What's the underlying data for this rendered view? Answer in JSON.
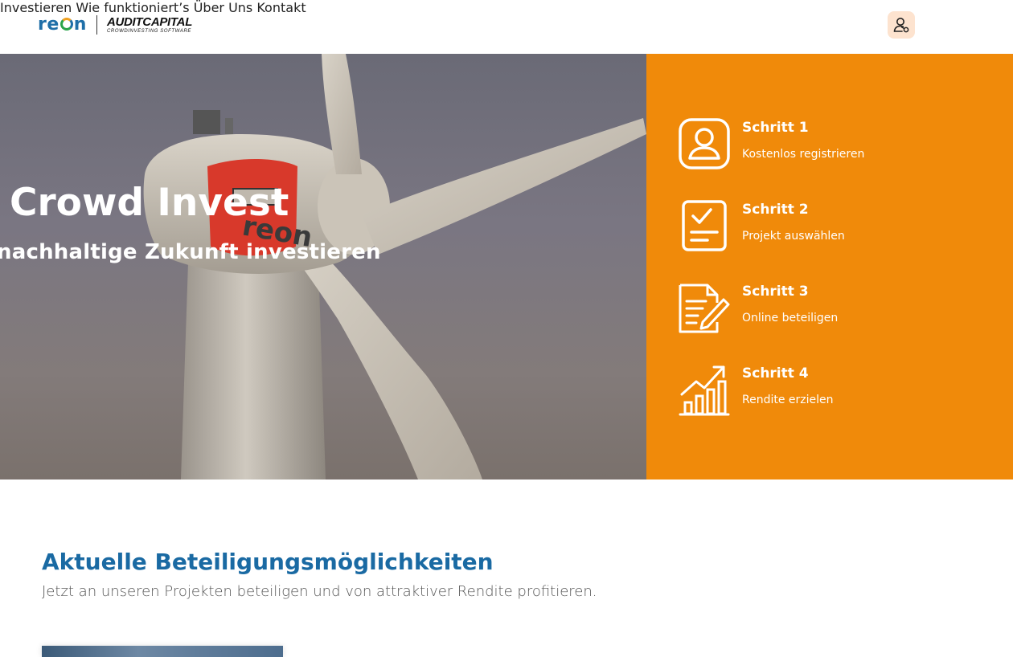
{
  "header": {
    "logo_reon_prefix": "re",
    "logo_reon_suffix": "n",
    "logo_auditcapital": "AUDITCAPITAL",
    "logo_auditcapital_tagline": "CROWDINVESTING SOFTWARE",
    "nav": [
      {
        "label": "Investieren"
      },
      {
        "label": "Wie funktioniert’s"
      },
      {
        "label": "Über Uns"
      },
      {
        "label": "Kontakt"
      }
    ],
    "user_icon": "user-key-icon"
  },
  "hero": {
    "title": "Crowd Invest",
    "subtitle": "nachhaltige Zukunft investieren",
    "image": "wind-turbine-photo",
    "nacelle_text": "reon"
  },
  "steps": [
    {
      "title": "Schritt 1",
      "text": "Kostenlos registrieren",
      "icon": "user-profile-icon"
    },
    {
      "title": "Schritt 2",
      "text": "Projekt auswählen",
      "icon": "checklist-icon"
    },
    {
      "title": "Schritt 3",
      "text": "Online beteiligen",
      "icon": "document-pen-icon"
    },
    {
      "title": "Schritt 4",
      "text": "Rendite erzielen",
      "icon": "growth-chart-icon"
    }
  ],
  "section": {
    "title": "Aktuelle Beteiligungsmöglichkeiten",
    "subtitle": "Jetzt an unseren Projekten beteiligen und von attraktiver Rendite profitieren."
  },
  "colors": {
    "accent_orange": "#f08a0a",
    "brand_blue": "#1a6aa3",
    "user_button_bg": "#fde3cf"
  }
}
